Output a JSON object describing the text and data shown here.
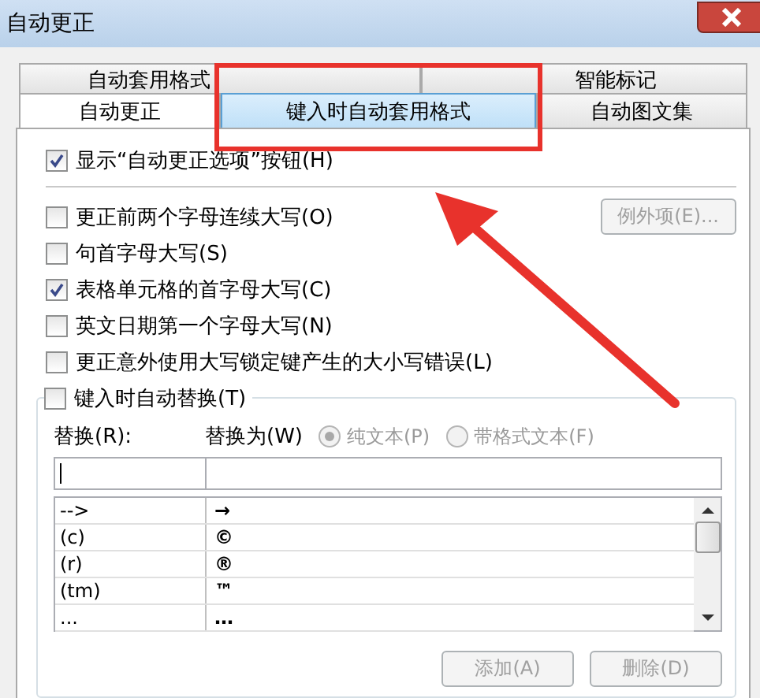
{
  "window": {
    "title": "自动更正"
  },
  "tab_rows": [
    [
      {
        "label": "自动套用格式",
        "selected": false
      },
      {
        "label": "智能标记",
        "selected": false
      }
    ],
    [
      {
        "label": "自动更正",
        "selected": false
      },
      {
        "label": "键入时自动套用格式",
        "selected": true
      },
      {
        "label": "自动图文集",
        "selected": false
      }
    ]
  ],
  "show_options_button": {
    "label": "显示“自动更正选项”按钮(H)",
    "checked": true
  },
  "options": [
    {
      "label": "更正前两个字母连续大写(O)",
      "checked": false
    },
    {
      "label": "句首字母大写(S)",
      "checked": false
    },
    {
      "label": "表格单元格的首字母大写(C)",
      "checked": true
    },
    {
      "label": "英文日期第一个字母大写(N)",
      "checked": false
    },
    {
      "label": "更正意外使用大写锁定键产生的大小写错误(L)",
      "checked": false
    }
  ],
  "exceptions_button": {
    "label": "例外项(E)...",
    "disabled": true
  },
  "replace_group": {
    "label": "键入时自动替换(T)",
    "checked": false,
    "replace_label": "替换(R):",
    "with_label": "替换为(W)",
    "radios": [
      {
        "label": "纯文本(P)",
        "selected": true,
        "disabled": true
      },
      {
        "label": "带格式文本(F)",
        "selected": false,
        "disabled": true
      }
    ],
    "rows": [
      {
        "replace": "-->",
        "with": "→"
      },
      {
        "replace": "(c)",
        "with": "©"
      },
      {
        "replace": "(r)",
        "with": "®"
      },
      {
        "replace": "(tm)",
        "with": "™"
      },
      {
        "replace": "...",
        "with": "…"
      }
    ],
    "buttons": [
      {
        "label": "添加(A)",
        "disabled": true
      },
      {
        "label": "删除(D)",
        "disabled": true
      }
    ]
  }
}
